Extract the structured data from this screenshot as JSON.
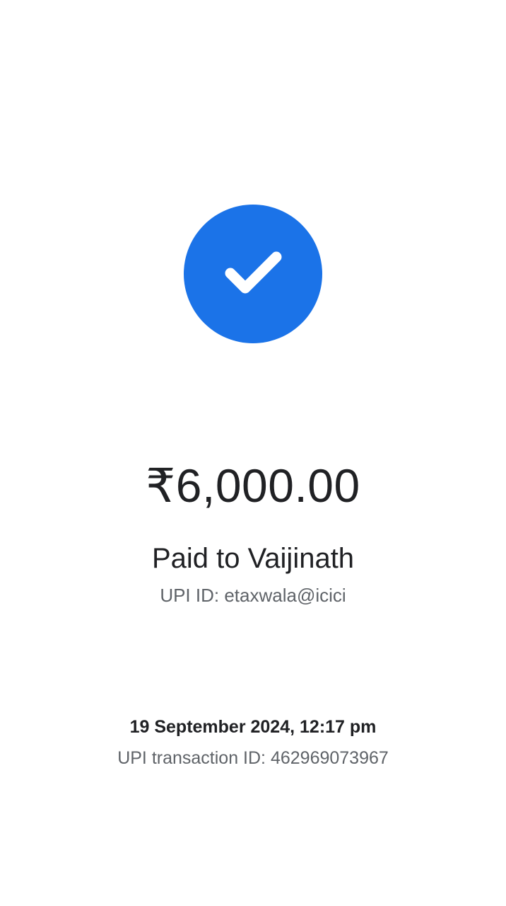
{
  "status": {
    "icon": "check-circle-icon",
    "color": "#1b73e8"
  },
  "payment": {
    "amount": "₹6,000.00",
    "paid_to": "Paid to Vaijinath",
    "upi_id": "UPI ID: etaxwala@icici"
  },
  "transaction": {
    "datetime": "19 September 2024, 12:17 pm",
    "transaction_id": "UPI transaction ID: 462969073967"
  }
}
